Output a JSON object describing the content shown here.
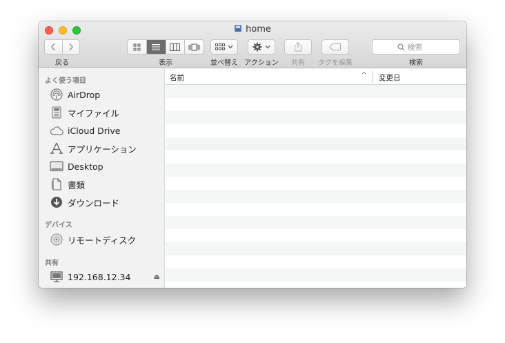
{
  "window": {
    "title": "home"
  },
  "toolbar": {
    "back_label": "戻る",
    "view_label": "表示",
    "arrange_label": "並べ替え",
    "action_label": "アクション",
    "share_label": "共有",
    "tags_label": "タグを編集",
    "search_label": "検索",
    "search_placeholder": "検索"
  },
  "sidebar": {
    "favorites_header": "よく使う項目",
    "favorites": [
      {
        "label": "AirDrop",
        "icon": "airdrop-icon"
      },
      {
        "label": "マイファイル",
        "icon": "all-files-icon"
      },
      {
        "label": "iCloud Drive",
        "icon": "cloud-icon"
      },
      {
        "label": "アプリケーション",
        "icon": "applications-icon"
      },
      {
        "label": "Desktop",
        "icon": "desktop-icon"
      },
      {
        "label": "書類",
        "icon": "documents-icon"
      },
      {
        "label": "ダウンロード",
        "icon": "downloads-icon"
      }
    ],
    "devices_header": "デバイス",
    "devices": [
      {
        "label": "リモートディスク",
        "icon": "disc-icon"
      }
    ],
    "shared_header": "共有",
    "shared": [
      {
        "label": "192.168.12.34",
        "icon": "server-icon",
        "eject": "⏏"
      }
    ]
  },
  "list": {
    "columns": {
      "name": "名前",
      "date_modified": "変更日"
    },
    "sort_indicator": "^"
  },
  "colors": {
    "close": "#fd5f57",
    "minimize": "#febc2e",
    "zoom": "#28c840",
    "row_stripe": "#f4f5f5"
  }
}
